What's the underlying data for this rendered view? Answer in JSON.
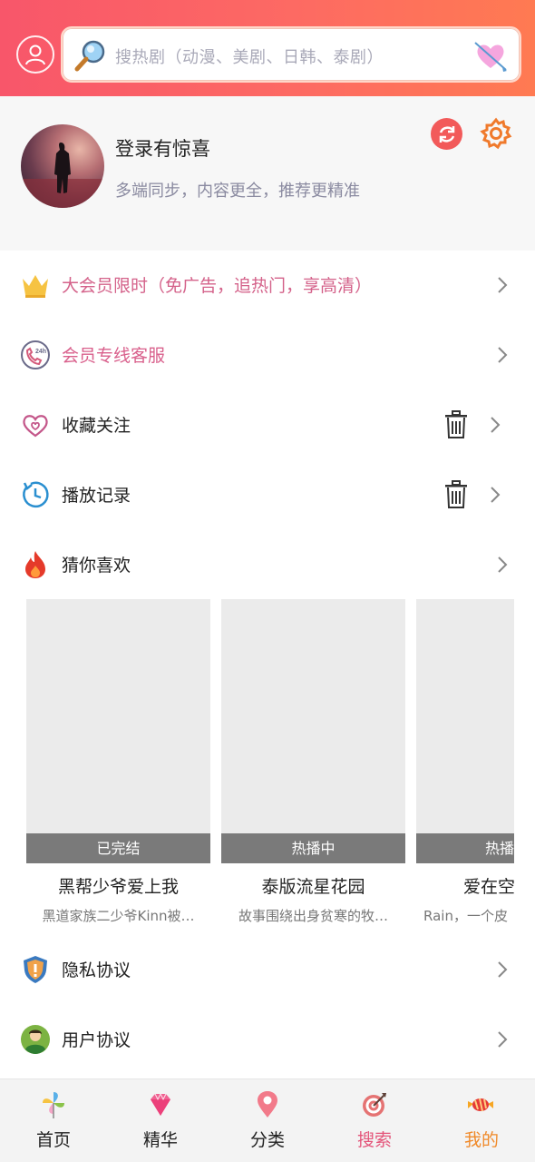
{
  "search": {
    "placeholder": "搜热剧（动漫、美剧、日韩、泰剧）"
  },
  "profile": {
    "title": "登录有惊喜",
    "subtitle": "多端同步，内容更全，推荐更精准"
  },
  "menu": {
    "vip": "大会员限时（免广告，追热门，享高清）",
    "service": "会员专线客服",
    "favorites": "收藏关注",
    "history": "播放记录",
    "guess": "猜你喜欢",
    "privacy": "隐私协议",
    "user_agreement": "用户协议"
  },
  "recommendations": [
    {
      "status": "已完结",
      "name": "黑帮少爷爱上我",
      "desc": "黑道家族二少爷Kinn被…"
    },
    {
      "status": "热播中",
      "name": "泰版流星花园",
      "desc": "故事围绕出身贫寒的牧…"
    },
    {
      "status": "热播",
      "name": "爱在空",
      "desc": "Rain，一个皮"
    }
  ],
  "bottom_nav": [
    {
      "label": "首页",
      "icon": "pinwheel-icon"
    },
    {
      "label": "精华",
      "icon": "diamond-icon"
    },
    {
      "label": "分类",
      "icon": "location-pin-icon"
    },
    {
      "label": "搜索",
      "icon": "target-icon"
    },
    {
      "label": "我的",
      "icon": "candy-icon"
    }
  ],
  "colors": {
    "header_start": "#f8566a",
    "header_end": "#ff7a52",
    "vip_text": "#d4628a",
    "nav_search": "#e4557a",
    "nav_mine": "#f08a2a"
  }
}
